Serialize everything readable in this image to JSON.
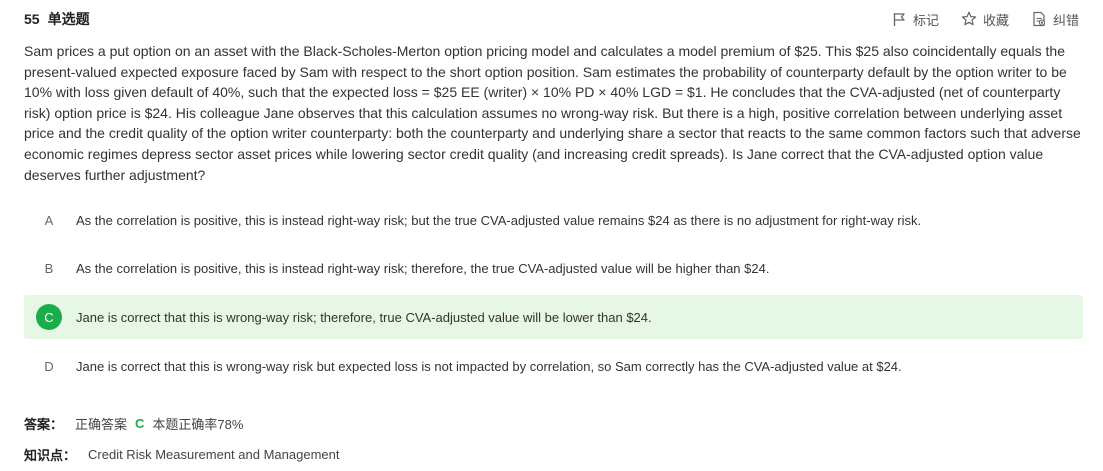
{
  "question": {
    "number": "55",
    "type": "单选题",
    "stem": "Sam prices a put option on an asset with the Black-Scholes-Merton option pricing model and calculates a model premium of $25. This $25 also coincidentally equals the present-valued expected exposure faced by Sam with respect to the short option position. Sam estimates the probability of counterparty default by the option writer to be 10% with loss given default of 40%, such that the expected loss = $25 EE (writer) × 10% PD × 40% LGD = $1. He concludes that the CVA-adjusted (net of counterparty risk) option price is $24. His colleague Jane observes that this calculation assumes no wrong-way risk. But there is a high, positive correlation between underlying asset price and the credit quality of the option writer counterparty: both the counterparty and underlying share a sector that reacts to the same common factors such that adverse economic regimes depress sector asset prices while lowering sector credit quality (and increasing credit spreads). Is Jane correct that the CVA-adjusted option value deserves further adjustment?"
  },
  "actions": {
    "mark": "标记",
    "favorite": "收藏",
    "report": "纠错"
  },
  "options": [
    {
      "letter": "A",
      "text": "As the correlation is positive, this is instead right-way risk; but the true CVA-adjusted value remains $24 as there is no adjustment for right-way risk."
    },
    {
      "letter": "B",
      "text": "As the correlation is positive, this is instead right-way risk; therefore, the true CVA-adjusted value will be higher than $24."
    },
    {
      "letter": "C",
      "text": "Jane is correct that this is wrong-way risk; therefore, true CVA-adjusted value will be lower than $24."
    },
    {
      "letter": "D",
      "text": "Jane is correct that this is wrong-way risk but expected loss is not impacted by correlation, so Sam correctly has the CVA-adjusted value at $24."
    }
  ],
  "correct_option": "C",
  "answer": {
    "label": "答案：",
    "correct_label": "正确答案",
    "correct_letter": "C",
    "accuracy_text": "本题正确率78%"
  },
  "knowledge": {
    "label": "知识点：",
    "value": "Credit Risk Measurement and Management"
  },
  "colors": {
    "correct_green": "#1aad4b",
    "correct_bg": "#e6f7e6",
    "text": "#333333"
  }
}
